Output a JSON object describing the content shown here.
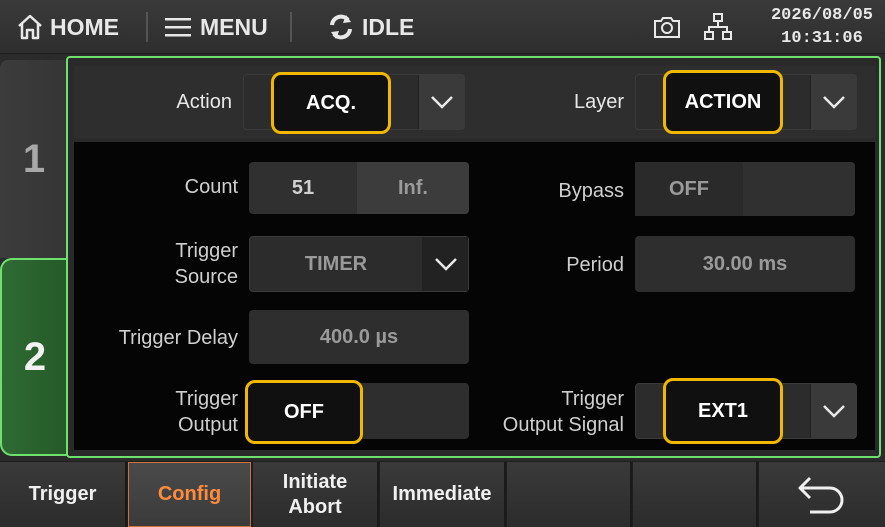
{
  "topbar": {
    "home_label": "HOME",
    "menu_label": "MENU",
    "status_label": "IDLE",
    "date": "2026/08/05",
    "time": "10:31:06"
  },
  "side_tabs": [
    {
      "label": "1"
    },
    {
      "label": "2"
    }
  ],
  "header": {
    "action_label": "Action",
    "action_value": "ACQ.",
    "layer_label": "Layer",
    "layer_value": "ACTION"
  },
  "settings": {
    "count_label": "Count",
    "count_value": "51",
    "count_inf": "Inf.",
    "bypass_label": "Bypass",
    "bypass_value": "OFF",
    "trigger_source_label_1": "Trigger",
    "trigger_source_label_2": "Source",
    "trigger_source_value": "TIMER",
    "period_label": "Period",
    "period_value": "30.00 ms",
    "trigger_delay_label": "Trigger Delay",
    "trigger_delay_value": "400.0 µs",
    "trigger_output_label_1": "Trigger",
    "trigger_output_label_2": "Output",
    "trigger_output_value": "OFF",
    "trigger_output_signal_label_1": "Trigger",
    "trigger_output_signal_label_2": "Output Signal",
    "trigger_output_signal_value": "EXT1"
  },
  "softkeys": {
    "trigger": "Trigger",
    "config": "Config",
    "initiate": "Initiate",
    "abort": "Abort",
    "immediate": "Immediate"
  },
  "colors": {
    "accent_green": "#6ee06e",
    "highlight_yellow": "#f2b800",
    "active_orange": "#ff8a3c"
  },
  "icons": [
    "home-icon",
    "menu-icon",
    "refresh-icon",
    "camera-icon",
    "network-icon",
    "chevron-down-icon",
    "back-arrow-icon"
  ]
}
